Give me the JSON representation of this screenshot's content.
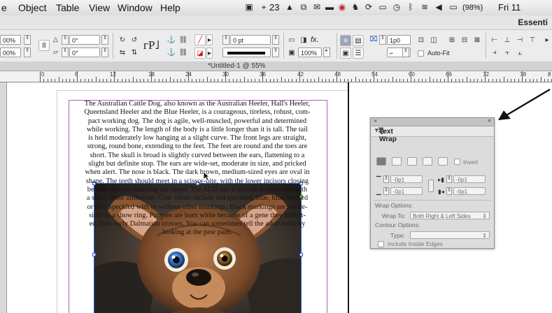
{
  "menubar": {
    "items": [
      "e",
      "Object",
      "Table",
      "View",
      "Window",
      "Help"
    ],
    "tray_text": "23",
    "battery": "(98%)",
    "clock": "Fri 11"
  },
  "workspace": {
    "name": "Essenti"
  },
  "control_panel": {
    "left_fields": [
      "00%",
      "00%"
    ],
    "angle_fields": [
      "0°",
      "0°"
    ],
    "stroke_weight": "0 pt",
    "scale": "100%",
    "spacing": "1p0",
    "auto_fit_label": "Auto-Fit",
    "fx_label": "fx."
  },
  "document": {
    "tab_title": "*Untitled-1 @ 55%"
  },
  "ruler": {
    "labels": [
      "0",
      "6",
      "12",
      "18",
      "24",
      "30",
      "36",
      "42",
      "48",
      "54",
      "60",
      "66",
      "72",
      "78",
      "8"
    ]
  },
  "body_text": {
    "lines": [
      "The Australian Cattle Dog, also known as the Australian Heeler, Hall's Heeler,",
      "Queensland Heeler and the Blue Heeler, is a courageous, tireless, robust, com-",
      "pact working dog. The dog is agile, well-muscled, powerful and determined",
      "while working. The length of the body is a little longer than it is tall. The tail",
      "is held moderately low hanging at a slight curve. The front legs are straight,",
      "strong, round bone, extending to the feet. The feet are round and the toes are",
      "short. The skull is broad is slightly curved between the ears, flattening to a",
      "slight but definite stop. The ears are wide-set, moderate in size, and pricked",
      "when alert. The nose is black. The dark brown, medium-sized eyes are oval in",
      "shape. The teeth should meet in a scissor-bite, with the lower incisors closing",
      "behind and just touching the upper. The ACD has a smooth double coat with",
      "a short dense undercoat. Coat colors include red speckled, blue, blue mottled",
      "or blue speckled with or without other markings. Black markings are not de-",
      "sired in a show ring. Puppies are born white because of a gene they inherit-",
      "ed from early Dalmatian crosses. You can sometimes tell the adult color by",
      "looking at the paw pads."
    ]
  },
  "text_wrap_panel": {
    "title": "Text Wrap",
    "invert_label": "Invert",
    "offsets": {
      "top": "-0p1",
      "bottom": "-0p1",
      "left": "-0p1",
      "right": "-0p1"
    },
    "wrap_options_label": "Wrap Options:",
    "wrap_to_label": "Wrap To:",
    "wrap_to_value": "Both Right & Left Sides",
    "contour_options_label": "Contour Options:",
    "type_label": "Type:",
    "type_value": "",
    "include_inside_edges_label": "Include Inside Edges"
  },
  "colors": {
    "frame_selection": "#2a5bd8",
    "margin_guide": "#b45fc0",
    "pasteboard": "#ffffff"
  }
}
